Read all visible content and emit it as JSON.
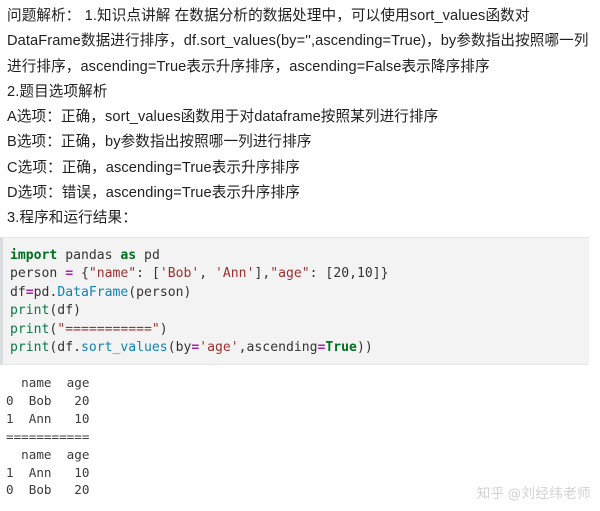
{
  "explanation": {
    "paragraph": "问题解析： 1.知识点讲解 在数据分析的数据处理中，可以使用sort_values函数对DataFrame数据进行排序，df.sort_values(by='',ascending=True)，by参数指出按照哪一列进行排序，ascending=True表示升序排序，ascending=False表示降序排序",
    "section2_heading": "2.题目选项解析",
    "options": [
      "A选项：正确，sort_values函数用于对dataframe按照某列进行排序",
      "B选项：正确，by参数指出按照哪一列进行排序",
      "C选项：正确，ascending=True表示升序排序",
      "D选项：错误，ascending=True表示升序排序"
    ],
    "section3_heading": "3.程序和运行结果："
  },
  "code": {
    "language": "python",
    "lines": [
      [
        {
          "t": "import",
          "c": "k"
        },
        {
          "t": " pandas ",
          "c": "pl"
        },
        {
          "t": "as",
          "c": "k"
        },
        {
          "t": " pd",
          "c": "pl"
        }
      ],
      [
        {
          "t": "person ",
          "c": "pl"
        },
        {
          "t": "=",
          "c": "op"
        },
        {
          "t": " {",
          "c": "pl"
        },
        {
          "t": "\"name\"",
          "c": "str"
        },
        {
          "t": ": [",
          "c": "pl"
        },
        {
          "t": "'Bob'",
          "c": "str"
        },
        {
          "t": ", ",
          "c": "pl"
        },
        {
          "t": "'Ann'",
          "c": "str"
        },
        {
          "t": "],",
          "c": "pl"
        },
        {
          "t": "\"age\"",
          "c": "str"
        },
        {
          "t": ": [",
          "c": "pl"
        },
        {
          "t": "20",
          "c": "num"
        },
        {
          "t": ",",
          "c": "pl"
        },
        {
          "t": "10",
          "c": "num"
        },
        {
          "t": "]}",
          "c": "pl"
        }
      ],
      [
        {
          "t": "df",
          "c": "pl"
        },
        {
          "t": "=",
          "c": "op"
        },
        {
          "t": "pd.",
          "c": "pl"
        },
        {
          "t": "DataFrame",
          "c": "nb"
        },
        {
          "t": "(person)",
          "c": "pl"
        }
      ],
      [
        {
          "t": "print",
          "c": "fn"
        },
        {
          "t": "(df)",
          "c": "pl"
        }
      ],
      [
        {
          "t": "print",
          "c": "fn"
        },
        {
          "t": "(",
          "c": "pl"
        },
        {
          "t": "\"===========\"",
          "c": "str"
        },
        {
          "t": ")",
          "c": "pl"
        }
      ],
      [
        {
          "t": "print",
          "c": "fn"
        },
        {
          "t": "(df.",
          "c": "pl"
        },
        {
          "t": "sort_values",
          "c": "nb"
        },
        {
          "t": "(by",
          "c": "pl"
        },
        {
          "t": "=",
          "c": "op"
        },
        {
          "t": "'age'",
          "c": "str"
        },
        {
          "t": ",ascending",
          "c": "pl"
        },
        {
          "t": "=",
          "c": "op"
        },
        {
          "t": "True",
          "c": "k"
        },
        {
          "t": "))",
          "c": "pl"
        }
      ]
    ]
  },
  "output": {
    "lines": [
      "  name  age",
      "0  Bob   20",
      "1  Ann   10",
      "===========",
      "  name  age",
      "1  Ann   10",
      "0  Bob   20"
    ]
  },
  "watermark": {
    "logo": "知乎",
    "author": "@刘经纬老师"
  },
  "colors": {
    "page_background": "#ffffff",
    "code_background": "#f3f3f3",
    "code_left_bar": "#d9dde0",
    "text": "#1f1f1f",
    "keyword": "#007020",
    "builtin": "#0e84b5",
    "string": "#9b3030",
    "operator": "#aa22aa",
    "function": "#0b7a4b",
    "watermark": "#d2d2d2"
  }
}
